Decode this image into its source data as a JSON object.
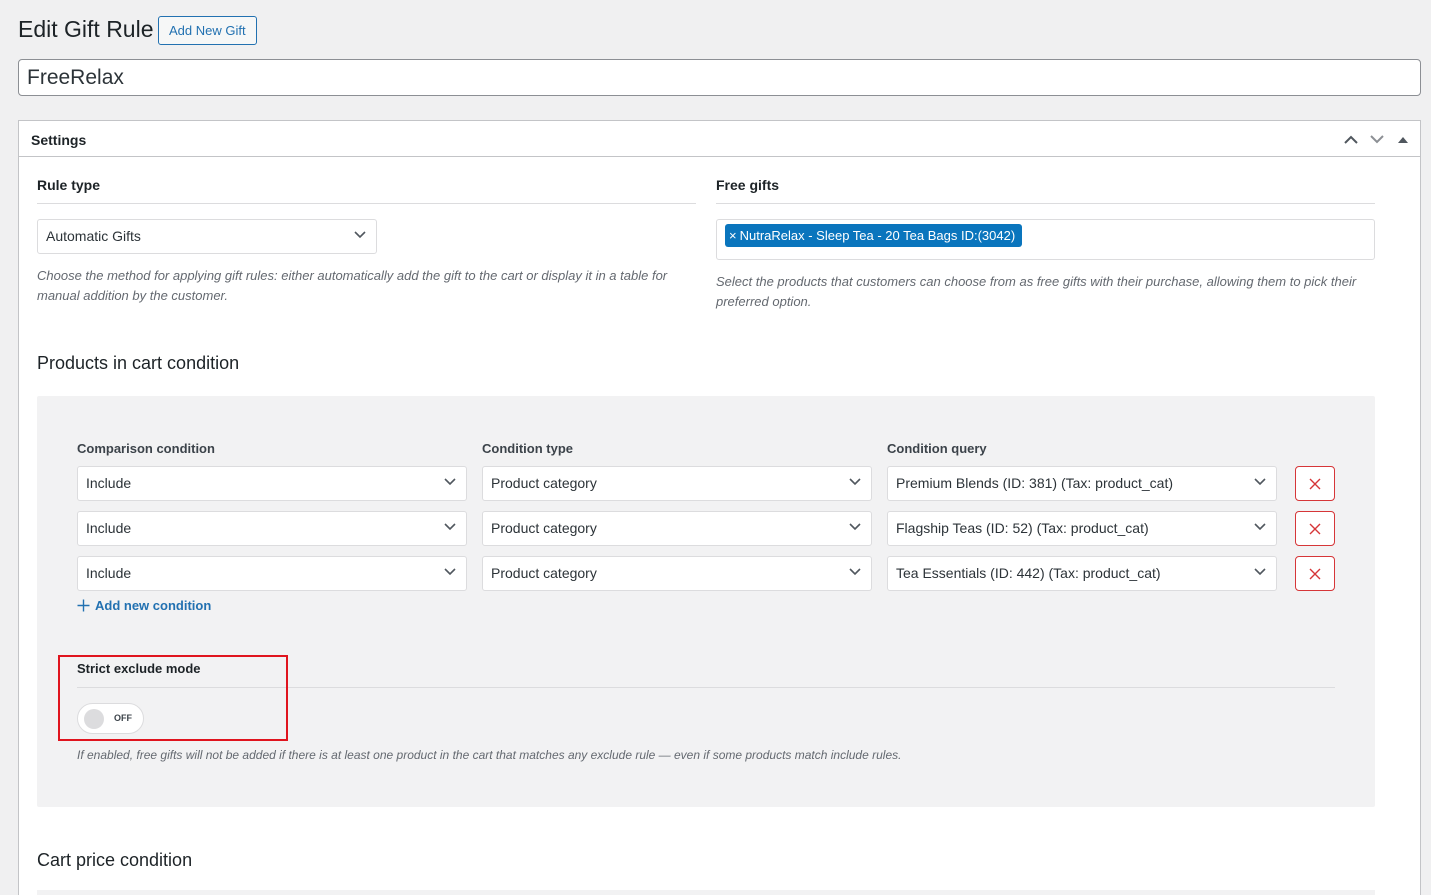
{
  "header": {
    "title": "Edit Gift Rule",
    "add_new_label": "Add New Gift"
  },
  "post_title": "FreeRelax",
  "settings": {
    "title": "Settings",
    "rule_type": {
      "label": "Rule type",
      "value": "Automatic Gifts",
      "description": "Choose the method for applying gift rules: either automatically add the gift to the cart or display it in a table for manual addition by the customer."
    },
    "free_gifts": {
      "label": "Free gifts",
      "tag": "NutraRelax - Sleep Tea - 20 Tea Bags ID:(3042)",
      "tag_remove": "×",
      "description": "Select the products that customers can choose from as free gifts with their purchase, allowing them to pick their preferred option."
    },
    "products_condition": {
      "heading": "Products in cart condition",
      "col_comparison": "Comparison condition",
      "col_type": "Condition type",
      "col_query": "Condition query",
      "rows": [
        {
          "comparison": "Include",
          "type": "Product category",
          "query": "Premium Blends (ID: 381) (Tax: product_cat)"
        },
        {
          "comparison": "Include",
          "type": "Product category",
          "query": "Flagship Teas (ID: 52) (Tax: product_cat)"
        },
        {
          "comparison": "Include",
          "type": "Product category",
          "query": "Tea Essentials (ID: 442) (Tax: product_cat)"
        }
      ],
      "add_condition": "Add new condition",
      "strict_mode": {
        "label": "Strict exclude mode",
        "toggle_state": "OFF",
        "description": "If enabled, free gifts will not be added if there is at least one product in the cart that matches any exclude rule — even if some products match include rules."
      }
    },
    "cart_price_condition": {
      "heading": "Cart price condition"
    }
  },
  "colors": {
    "accent": "#2271b1",
    "tag_bg": "#0a75bd",
    "delete": "#d63638",
    "highlight": "#e0141e"
  }
}
